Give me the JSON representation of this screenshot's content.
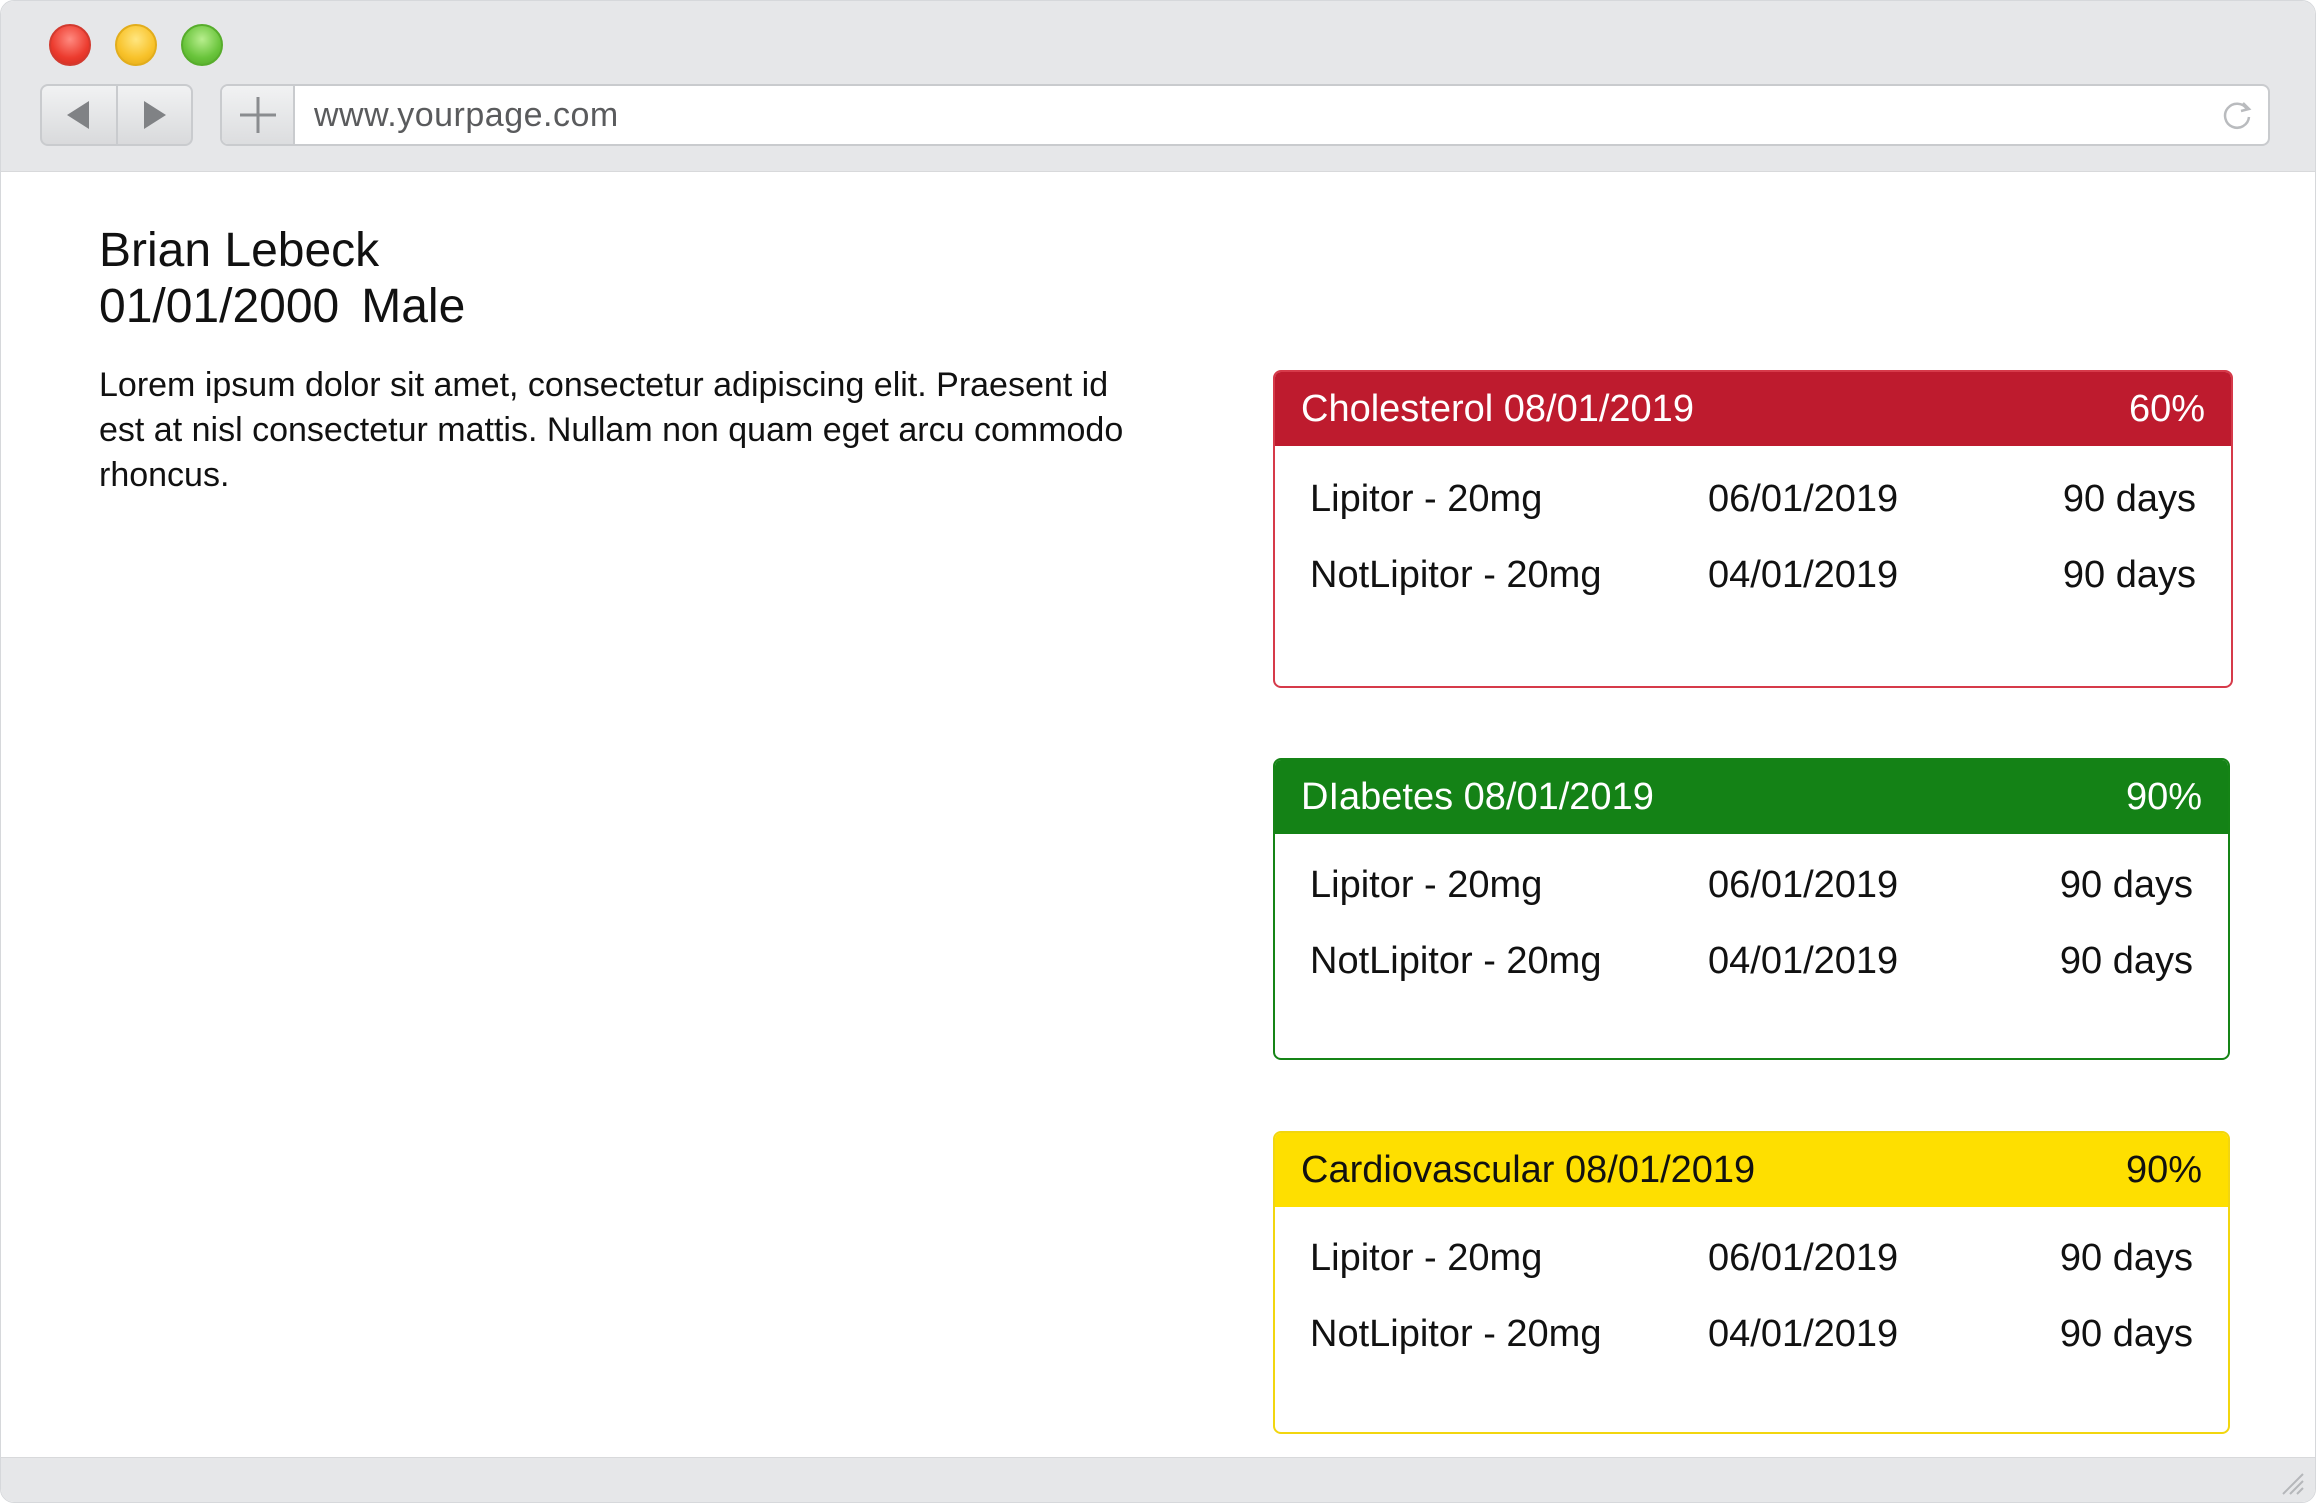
{
  "browser": {
    "url": "www.yourpage.com",
    "icons": {
      "back": "back-arrow-icon",
      "forward": "forward-arrow-icon",
      "new_tab": "plus-icon",
      "reload": "reload-icon",
      "resize": "resize-grip-icon"
    }
  },
  "patient": {
    "name": "Brian Lebeck",
    "dob": "01/01/2000",
    "sex": "Male",
    "description": "Lorem ipsum dolor sit amet, consectetur adipiscing elit. Praesent id est at nisl consectetur mattis. Nullam non quam eget arcu commodo rhoncus."
  },
  "conditions": [
    {
      "title": "Cholesterol  08/01/2019",
      "percent": "60%",
      "color": "#be1b2e",
      "medications": [
        {
          "name": "Lipitor - 20mg",
          "date": "06/01/2019",
          "duration": "90 days"
        },
        {
          "name": "NotLipitor - 20mg",
          "date": "04/01/2019",
          "duration": "90 days"
        }
      ]
    },
    {
      "title": "DIabetes  08/01/2019",
      "percent": "90%",
      "color": "#148216",
      "medications": [
        {
          "name": "Lipitor - 20mg",
          "date": "06/01/2019",
          "duration": "90 days"
        },
        {
          "name": "NotLipitor - 20mg",
          "date": "04/01/2019",
          "duration": "90 days"
        }
      ]
    },
    {
      "title": "Cardiovascular 08/01/2019",
      "percent": "90%",
      "color": "#fedf00",
      "medications": [
        {
          "name": "Lipitor - 20mg",
          "date": "06/01/2019",
          "duration": "90 days"
        },
        {
          "name": "NotLipitor - 20mg",
          "date": "04/01/2019",
          "duration": "90 days"
        }
      ]
    }
  ]
}
